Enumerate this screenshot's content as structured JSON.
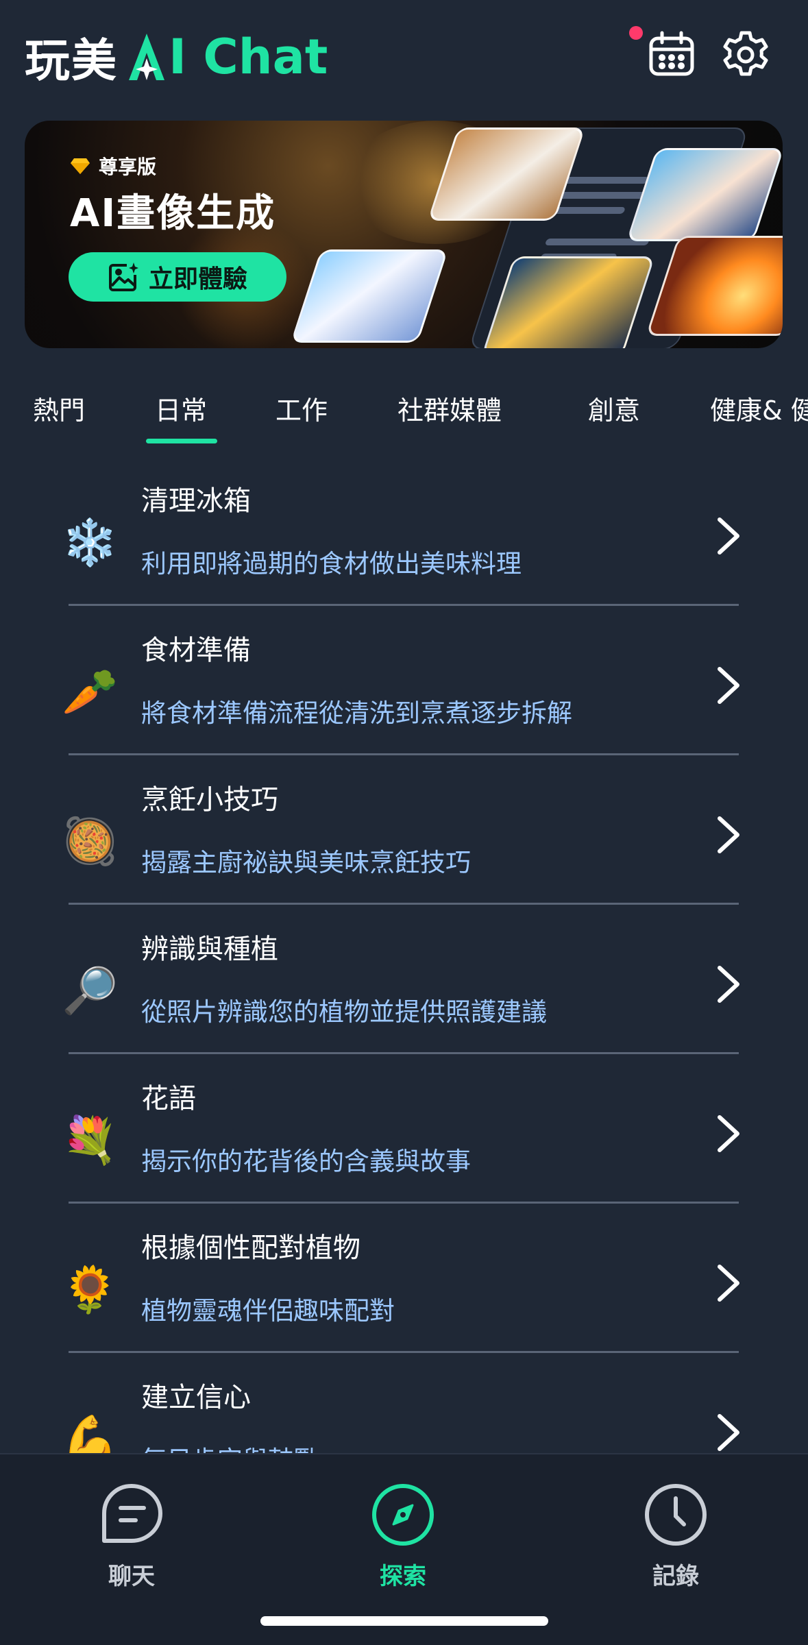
{
  "header": {
    "logo_cn": "玩美",
    "logo_en": "I Chat",
    "calendar_icon": "calendar-icon",
    "settings_icon": "gear-icon",
    "notification_dot_color": "#ff3a6b"
  },
  "banner": {
    "badge": "尊享版",
    "title": "AI畫像生成",
    "cta_label": "立即體驗"
  },
  "tabs": [
    {
      "label": "熱門"
    },
    {
      "label": "日常"
    },
    {
      "label": "工作"
    },
    {
      "label": "社群媒體"
    },
    {
      "label": "創意"
    },
    {
      "label": "健康& 健"
    }
  ],
  "active_tab": "日常",
  "list": {
    "items": [
      {
        "emoji": "❄️",
        "title": "清理冰箱",
        "subtitle": "利用即將過期的食材做出美味料理"
      },
      {
        "emoji": "🥕",
        "title": "食材準備",
        "subtitle": "將食材準備流程從清洗到烹煮逐步拆解"
      },
      {
        "emoji": "🥘",
        "title": "烹飪小技巧",
        "subtitle": "揭露主廚祕訣與美味烹飪技巧"
      },
      {
        "emoji": "🔎",
        "title": "辨識與種植",
        "subtitle": "從照片辨識您的植物並提供照護建議"
      },
      {
        "emoji": "💐",
        "title": "花語",
        "subtitle": "揭示你的花背後的含義與故事"
      },
      {
        "emoji": "🌻",
        "title": "根據個性配對植物",
        "subtitle": "植物靈魂伴侶趣味配對"
      },
      {
        "emoji": "💪",
        "title": "建立信心",
        "subtitle": "每日肯定與鼓勵"
      }
    ]
  },
  "bottom_nav": {
    "chat_label": "聊天",
    "explore_label": "探索",
    "history_label": "記錄",
    "active_color": "#1fe3a3",
    "inactive_color": "#c9ced6"
  }
}
